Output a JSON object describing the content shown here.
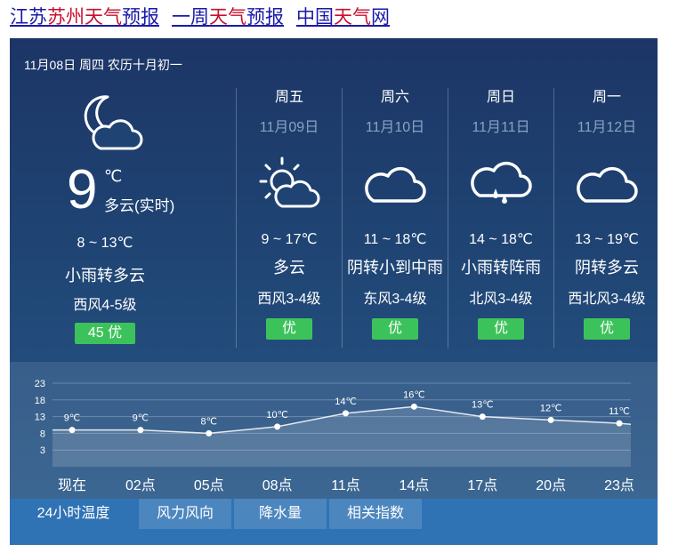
{
  "header": {
    "link1": {
      "prefix": "江苏",
      "red": "苏州天气",
      "suffix": "预报"
    },
    "link2": {
      "prefix": "一周",
      "red": "天气",
      "suffix": "预报"
    },
    "link3": {
      "prefix": "中国",
      "red": "天气",
      "suffix": "网"
    }
  },
  "today": {
    "date": "11月08日 周四 农历十月初一",
    "icon": "moon-cloud-icon",
    "temp": "9",
    "unit": "℃",
    "desc": "多云(实时)",
    "range": "8 ~ 13℃",
    "weather": "小雨转多云",
    "wind": "西风4-5级",
    "aqi": "45 优"
  },
  "forecast": [
    {
      "day": "周五",
      "date": "11月09日",
      "icon": "partly-sunny-icon",
      "range": "9 ~ 17℃",
      "weather": "多云",
      "wind": "西风3-4级",
      "aqi": "优"
    },
    {
      "day": "周六",
      "date": "11月10日",
      "icon": "cloud-icon",
      "range": "11 ~ 18℃",
      "weather": "阴转小到中雨",
      "wind": "东风3-4级",
      "aqi": "优"
    },
    {
      "day": "周日",
      "date": "11月11日",
      "icon": "rain-cloud-icon",
      "range": "14 ~ 18℃",
      "weather": "小雨转阵雨",
      "wind": "北风3-4级",
      "aqi": "优"
    },
    {
      "day": "周一",
      "date": "11月12日",
      "icon": "cloud-icon",
      "range": "13 ~ 19℃",
      "weather": "阴转多云",
      "wind": "西北风3-4级",
      "aqi": "优"
    }
  ],
  "chart_data": {
    "type": "line",
    "categories": [
      "现在",
      "02点",
      "05点",
      "08点",
      "11点",
      "14点",
      "17点",
      "20点",
      "23点"
    ],
    "series": [
      {
        "values": [
          9,
          9,
          8,
          10,
          14,
          16,
          13,
          12,
          11
        ]
      }
    ],
    "point_labels": [
      "9℃",
      "9℃",
      "8℃",
      "10℃",
      "14℃",
      "16℃",
      "13℃",
      "12℃",
      "11℃"
    ],
    "y_ticks": [
      "23",
      "18",
      "13",
      "8",
      "3"
    ],
    "ylim": [
      -2,
      23
    ],
    "grid": true
  },
  "tabs": [
    "24小时温度",
    "风力风向",
    "降水量",
    "相关指数"
  ],
  "colors": {
    "aqi_good": "#3cc25a",
    "link": "#1a1aa8",
    "highlight": "#c8102e"
  }
}
